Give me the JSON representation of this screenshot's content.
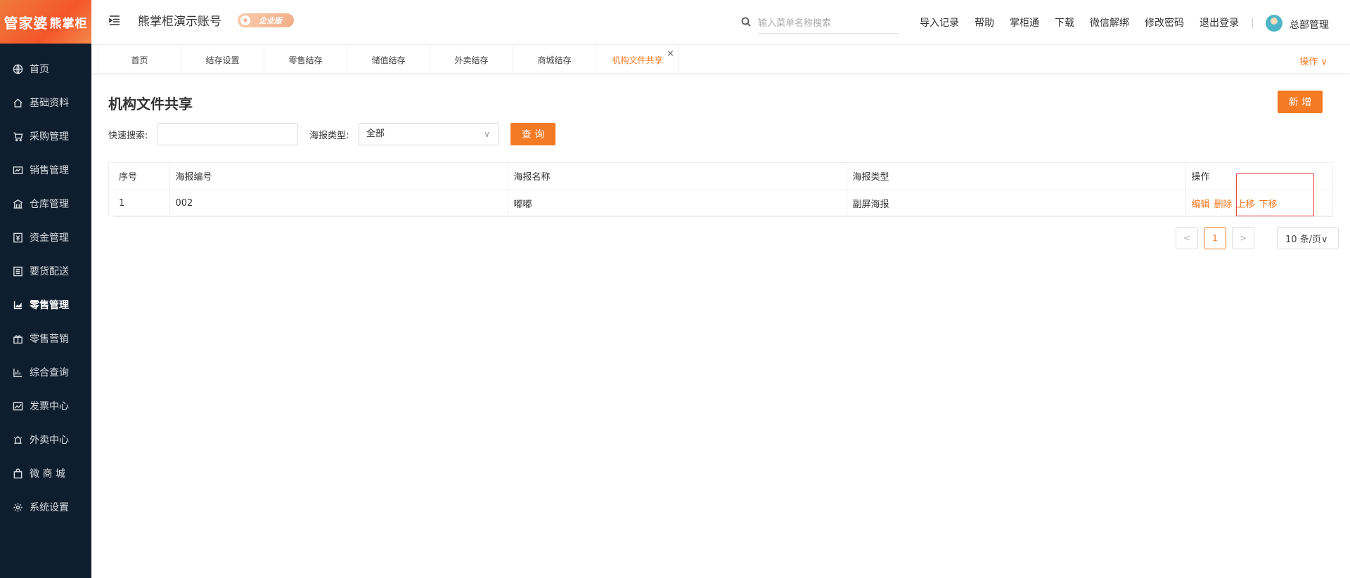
{
  "sidebar": {
    "logo_main": "管家婆",
    "logo_sub": "熊掌柜",
    "items": [
      {
        "label": "首页",
        "icon": "globe-icon"
      },
      {
        "label": "基础资料",
        "icon": "home-icon"
      },
      {
        "label": "采购管理",
        "icon": "cart-icon"
      },
      {
        "label": "销售管理",
        "icon": "sales-icon"
      },
      {
        "label": "仓库管理",
        "icon": "warehouse-icon"
      },
      {
        "label": "资金管理",
        "icon": "money-icon"
      },
      {
        "label": "要货配送",
        "icon": "list-icon"
      },
      {
        "label": "零售管理",
        "icon": "chart-icon"
      },
      {
        "label": "零售营销",
        "icon": "gift-icon"
      },
      {
        "label": "综合查询",
        "icon": "bar-chart-icon"
      },
      {
        "label": "发票中心",
        "icon": "trend-icon"
      },
      {
        "label": "外卖中心",
        "icon": "alarm-icon"
      },
      {
        "label": "微 商 城",
        "icon": "bag-icon"
      },
      {
        "label": "系统设置",
        "icon": "gear-icon"
      }
    ]
  },
  "header": {
    "account_name": "熊掌柜演示账号",
    "badge": "企业版",
    "search_placeholder": "输入菜单名称搜索",
    "links": [
      "导入记录",
      "帮助",
      "掌柜通",
      "下载",
      "微信解绑",
      "修改密码",
      "退出登录"
    ],
    "user": "总部管理"
  },
  "tabs": {
    "items": [
      "首页",
      "结存设置",
      "零售结存",
      "储值结存",
      "外卖结存",
      "商城结存",
      "机构文件共享"
    ],
    "active": "机构文件共享",
    "close": "×",
    "operations": "操作 ∨"
  },
  "page": {
    "title": "机构文件共享",
    "add_button": "新 增",
    "quick_search_label": "快速搜索:",
    "type_label": "海报类型:",
    "type_value": "全部",
    "type_chevron": "∨",
    "query_button": "查 询"
  },
  "table": {
    "columns": [
      "序号",
      "海报编号",
      "海报名称",
      "海报类型",
      "操作"
    ],
    "rows": [
      {
        "index": "1",
        "code": "002",
        "name": "嘟嘟",
        "type": "副屏海报",
        "ops": [
          "编辑",
          "删除",
          "上移",
          "下移"
        ]
      }
    ]
  },
  "pagination": {
    "prev": "<",
    "current": "1",
    "next": ">",
    "page_size": "10 条/页∨"
  },
  "colors": {
    "accent": "#f57a24",
    "sidebar_bg": "#0f1e2e",
    "highlight": "#e84b4b"
  }
}
